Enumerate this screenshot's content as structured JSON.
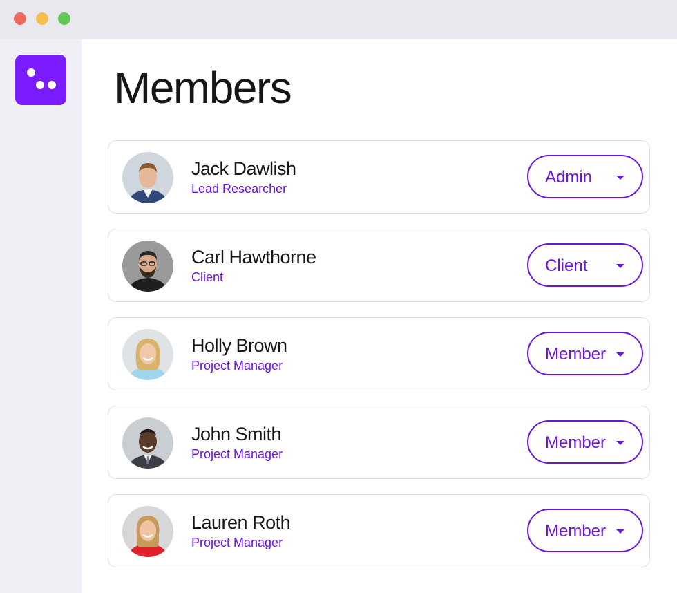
{
  "page": {
    "title": "Members"
  },
  "window": {
    "controls": [
      "close",
      "minimize",
      "maximize"
    ]
  },
  "logo": {
    "icon": "three-dots-logo-icon",
    "color": "#7a1cff"
  },
  "members": [
    {
      "name": "Jack Dawlish",
      "role": "Lead Researcher",
      "permission": "Admin"
    },
    {
      "name": "Carl Hawthorne",
      "role": "Client",
      "permission": "Client"
    },
    {
      "name": "Holly Brown",
      "role": "Project Manager",
      "permission": "Member"
    },
    {
      "name": "John Smith",
      "role": "Project Manager",
      "permission": "Member"
    },
    {
      "name": "Lauren Roth",
      "role": "Project Manager",
      "permission": "Member"
    }
  ],
  "colors": {
    "accent": "#6a14e0",
    "text": "#161616",
    "border": "#dedde3",
    "sidebar": "#f1eff6"
  }
}
